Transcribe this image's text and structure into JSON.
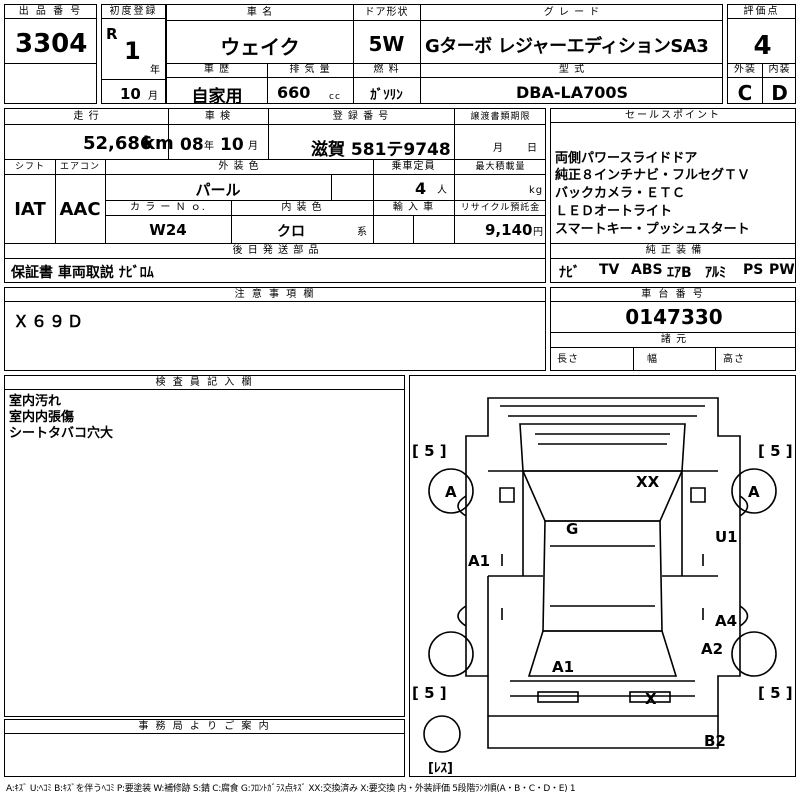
{
  "lot": {
    "label": "出 品 番 号",
    "value": "3304"
  },
  "first_reg": {
    "label": "初度登録",
    "era": "R",
    "year": "1",
    "year_unit": "年",
    "month": "10",
    "month_unit": "月"
  },
  "car_name": {
    "label": "車 名",
    "value": "ウェイク"
  },
  "door": {
    "label": "ドア形状",
    "value": "5W"
  },
  "grade": {
    "label": "グ レ ー ド",
    "value": "Gターボ レジャーエディションSA3"
  },
  "score": {
    "label": "評価点",
    "value": "4"
  },
  "history": {
    "label": "車 歴",
    "value": "自家用"
  },
  "displacement": {
    "label": "排 気 量",
    "value": "660",
    "unit": "cc"
  },
  "fuel": {
    "label": "燃 料",
    "value": "ｶﾞｿﾘﾝ"
  },
  "model": {
    "label": "型 式",
    "value": "DBA-LA700S"
  },
  "exterior": {
    "label": "外装",
    "value": "C"
  },
  "interior": {
    "label": "内装",
    "value": "D"
  },
  "mileage": {
    "label": "走 行",
    "value": "52,686",
    "unit": "km"
  },
  "inspection": {
    "label": "車 検",
    "year": "08",
    "year_unit": "年",
    "month": "10",
    "month_unit": "月"
  },
  "reg_no": {
    "label": "登 録 番 号",
    "value": "滋賀 581テ9748"
  },
  "transfer": {
    "label": "譲渡書類期限",
    "month_unit": "月",
    "day_unit": "日"
  },
  "shift": {
    "label": "シフト",
    "value": "IAT"
  },
  "aircon": {
    "label": "エアコン",
    "value": "AAC"
  },
  "color": {
    "label": "外 装 色",
    "value": "パール"
  },
  "capacity": {
    "label": "乗車定員",
    "value": "4",
    "unit": "人"
  },
  "max_load": {
    "label": "最大積載量",
    "unit": "kg"
  },
  "color_no": {
    "label": "カ ラ ー Ｎ ｏ.",
    "value": "W24"
  },
  "int_color": {
    "label": "内 装 色",
    "value": "クロ",
    "unit": "系"
  },
  "import": {
    "label": "輸 入 車"
  },
  "recycle": {
    "label": "リサイクル預託金",
    "value": "9,140",
    "unit": "円"
  },
  "later_parts": {
    "label": "後 日 発 送 部 品",
    "value": "保証書 車両取説 ﾅﾋﾞﾛﾑ"
  },
  "sales": {
    "label": "セールスポイント",
    "items": [
      "両側パワースライドドア",
      "純正８インチナビ・フルセグＴＶ",
      "バックカメラ・ＥＴＣ",
      "ＬＥＤオートライト",
      "スマートキー・プッシュスタート"
    ]
  },
  "equipment": {
    "label": "純 正 装 備",
    "items": [
      "ﾅﾋﾞ",
      "TV",
      "ABS",
      "ｴｱB",
      "ｱﾙﾐ",
      "PS",
      "PW"
    ]
  },
  "caution": {
    "label": "注 意 事 項 欄",
    "value": "Ｘ６９Ｄ"
  },
  "chassis": {
    "label": "車 台 番 号",
    "value": "0147330"
  },
  "specs": {
    "label": "諸 元",
    "length": "長さ",
    "width": "幅",
    "height": "高さ"
  },
  "inspector": {
    "label": "検 査 員 記 入 欄",
    "lines": [
      "室内汚れ",
      "室内内張傷",
      "シートタバコ穴大"
    ]
  },
  "office": {
    "label": "事 務 局 よ り ご 案 内"
  },
  "diagram": {
    "tire_5_tl": "[ 5 ]",
    "tire_5_tr": "[ 5 ]",
    "tire_5_bl": "[ 5 ]",
    "tire_5_br": "[ 5 ]",
    "wheel_fl": "A",
    "wheel_fr": "A",
    "xx": "XX",
    "g": "G",
    "a1_left": "A1",
    "u1": "U1",
    "a4": "A4",
    "a2": "A2",
    "a1_bottom": "A1",
    "x_rear": "X",
    "b2": "B2",
    "spare": "[ﾚｽ]"
  },
  "legend": "A:ｷｽﾞ U:ﾍｺﾐ B:ｷｽﾞを伴うﾍｺﾐ P:要塗装 W:補修跡 S:錆 C:腐食 G:ﾌﾛﾝﾄｶﾞﾗｽ点ｷｽﾞ XX:交換済み X:要交換 内・外装評価 5段階ﾗﾝｸ順(A・B・C・D・E) 1"
}
